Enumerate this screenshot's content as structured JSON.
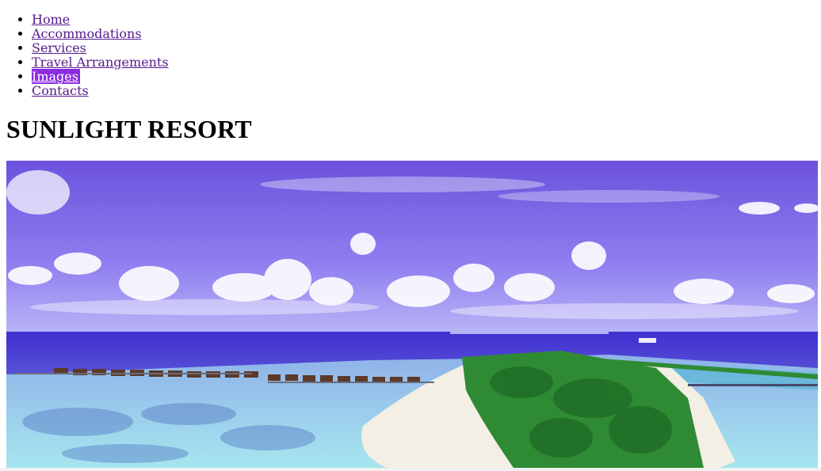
{
  "nav": {
    "items": [
      {
        "label": "Home",
        "active": false
      },
      {
        "label": "Accommodations",
        "active": false
      },
      {
        "label": "Services",
        "active": false
      },
      {
        "label": "Travel Arrangements",
        "active": false
      },
      {
        "label": "Images",
        "active": true
      },
      {
        "label": "Contacts",
        "active": false
      }
    ],
    "active_color": "#8a2be2",
    "link_color": "#551a8b"
  },
  "header": {
    "title": "SUNLIGHT RESORT"
  },
  "hero": {
    "tint_color": "#6a4fd8",
    "sea_color": "#3a36c8",
    "lagoon_color": "#7fd3e6",
    "foliage_color": "#2e8b2e"
  }
}
